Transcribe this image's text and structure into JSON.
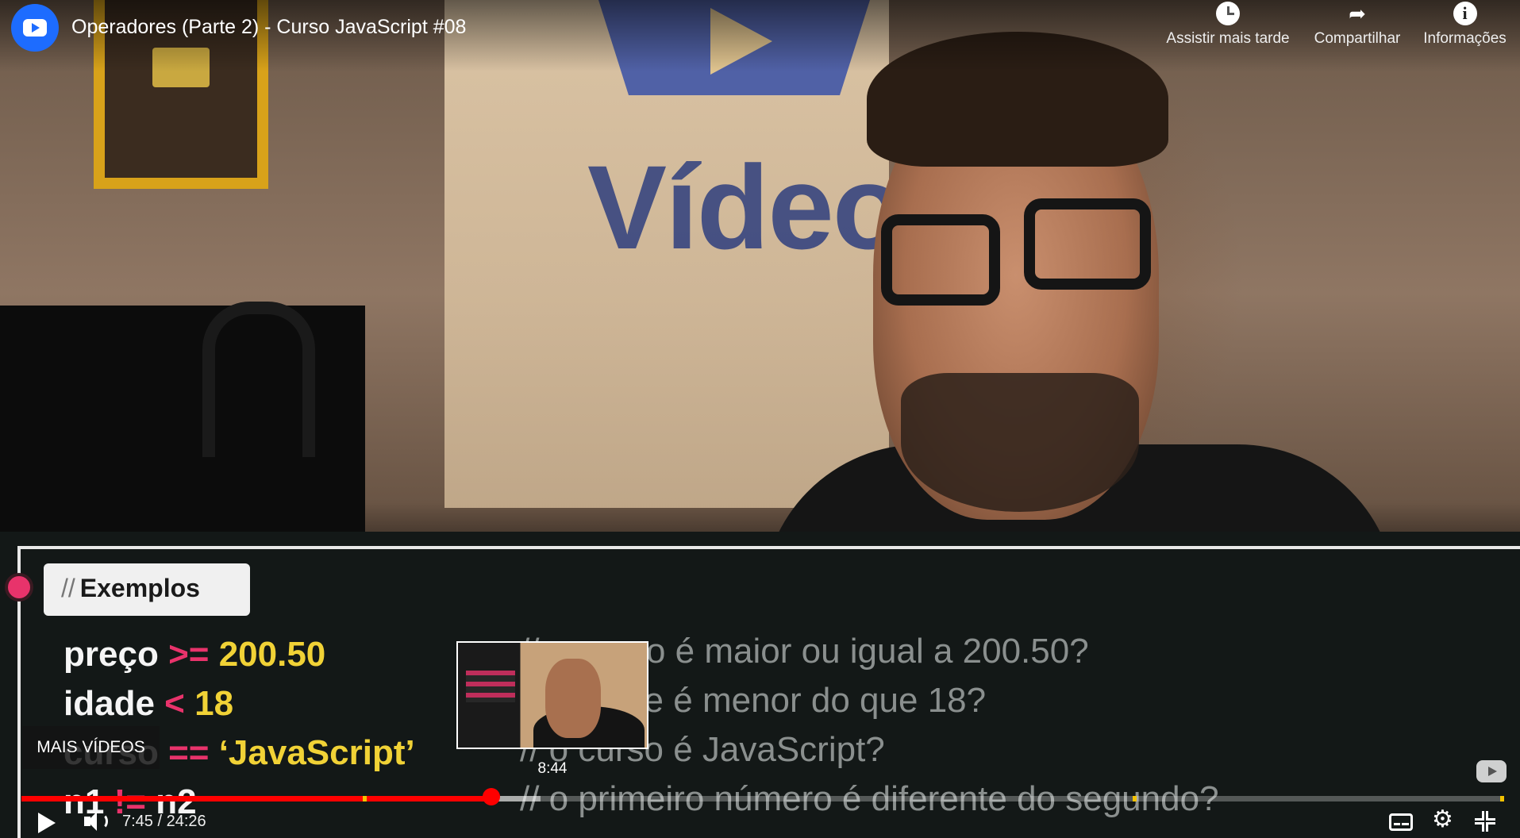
{
  "header": {
    "title": "Operadores (Parte 2) - Curso JavaScript #08",
    "actions": {
      "watch_later": "Assistir mais tarde",
      "share": "Compartilhar",
      "info": "Informações"
    },
    "info_glyph": "i"
  },
  "slide": {
    "heading_slash": "//",
    "heading": "Exemplos",
    "lines": [
      {
        "var": "preço",
        "op": ">=",
        "value": "200.50",
        "comment": "// o preço é maior ou igual a 200.50?"
      },
      {
        "var": "idade",
        "op": "<",
        "value": "18",
        "comment": "// a idade é menor do que 18?"
      },
      {
        "var": "curso",
        "op": "==",
        "value": "‘JavaScript’",
        "comment": "// o curso é JavaScript?"
      },
      {
        "var": "n1",
        "op": "!=",
        "value": "n2",
        "comment": "// o primeiro número é diferente do segundo?"
      }
    ],
    "logo_word": "Vídeo"
  },
  "overlay": {
    "more_videos": "MAIS VÍDEOS",
    "preview_time": "8:44"
  },
  "player": {
    "current_time": "7:45",
    "duration": "24:26",
    "time_display": "7:45 / 24:26",
    "progress_fraction": 0.317,
    "buffered_fraction": 0.35,
    "settings_glyph": "⚙",
    "colors": {
      "progress": "#ff0000",
      "chapter_marker": "#f2c200",
      "logo_blue": "#1d6cff",
      "operator_pink": "#e8336b",
      "value_yellow": "#f1d236"
    },
    "icons": [
      "play-icon",
      "volume-icon",
      "subtitles-icon",
      "settings-icon",
      "exit-fullscreen-icon"
    ]
  }
}
